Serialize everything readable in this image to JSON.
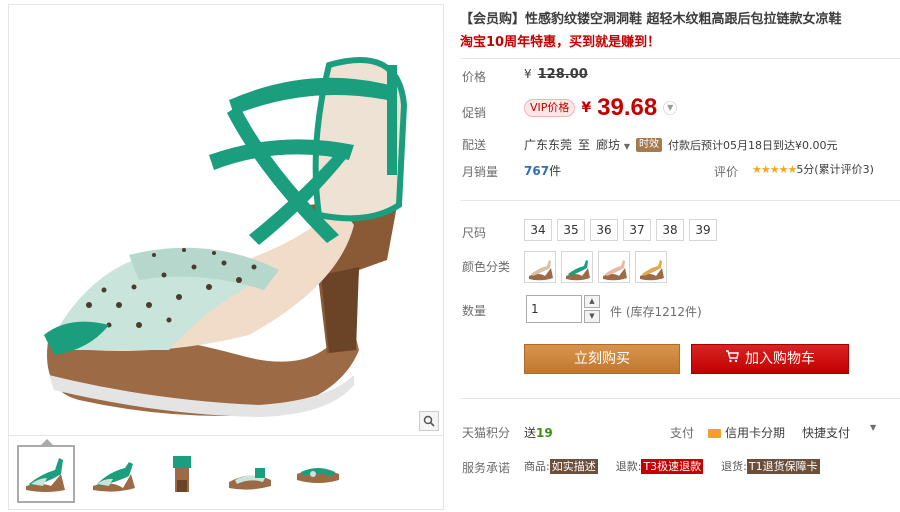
{
  "product": {
    "title": "【会员购】性感豹纹镂空洞洞鞋 超轻木纹粗高跟后包拉链款女凉鞋",
    "subtitle": "淘宝10周年特惠，买到就是赚到！"
  },
  "price": {
    "label": "价格",
    "currency": "¥",
    "original": "128.00"
  },
  "promo": {
    "label": "促销",
    "badge": "VIP价格",
    "currency": "¥",
    "price": "39.68"
  },
  "shipping": {
    "label": "配送",
    "from": "广东东莞",
    "to_word": "至",
    "to": "廊坊",
    "tag": "时效",
    "text": "付款后预计05月18日到达¥0.00元"
  },
  "sales": {
    "label": "月销量",
    "count": "767",
    "unit": "件",
    "rating_label": "评价",
    "stars": "★★★★★",
    "rating_text": "5分(累计评价3)"
  },
  "sizes": {
    "label": "尺码",
    "options": [
      "34",
      "35",
      "36",
      "37",
      "38",
      "39"
    ]
  },
  "colors": {
    "label": "颜色分类",
    "swatches": [
      "beige",
      "green",
      "pink",
      "tan"
    ]
  },
  "quantity": {
    "label": "数量",
    "value": "1",
    "stock_text": "件 (库存1212件)"
  },
  "buttons": {
    "buy": "立刻购买",
    "cart": "加入购物车"
  },
  "points": {
    "label": "天猫积分",
    "prefix": "送",
    "value": "19",
    "pay_label": "支付",
    "credit": "信用卡分期",
    "quick": "快捷支付"
  },
  "service": {
    "label": "服务承诺",
    "items": [
      {
        "pre": "商品:",
        "tag": "如实描述"
      },
      {
        "pre": "退款:",
        "tag": "T3极速退款"
      },
      {
        "pre": "退货:",
        "tag": "T1退货保障卡"
      }
    ]
  },
  "colors_theme": {
    "accent_red": "#c40000",
    "buy_orange": "#c07731",
    "teal_shoe": "#1a9e7e"
  }
}
